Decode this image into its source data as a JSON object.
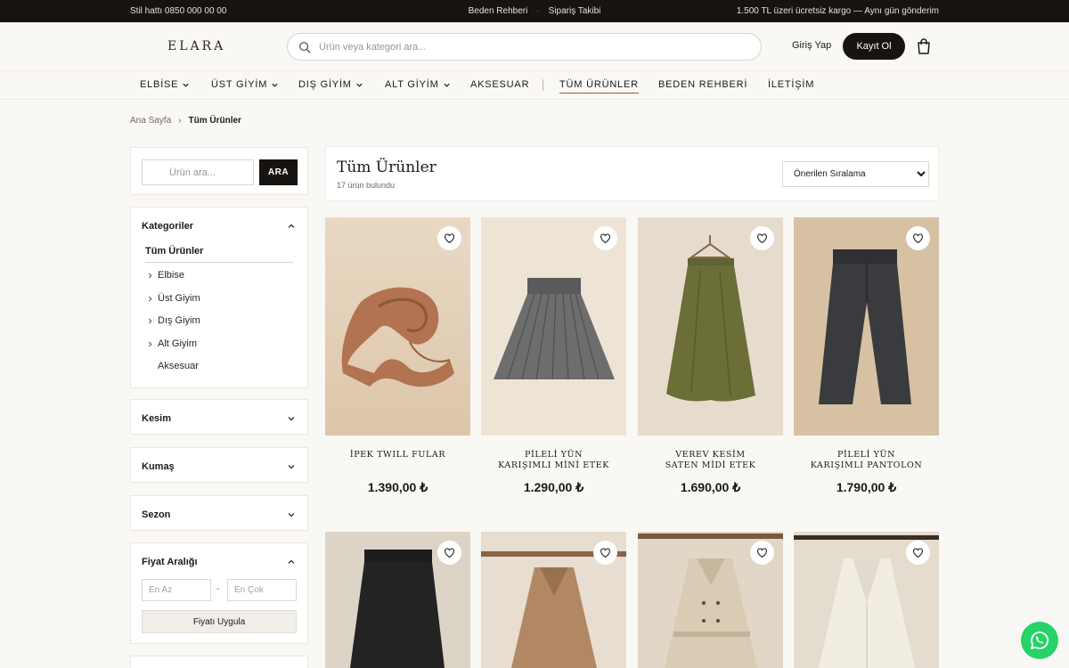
{
  "topbar": {
    "hotline": "Stil hattı 0850 000 00 00",
    "links": [
      "Beden Rehberi",
      "Sipariş Takibi"
    ],
    "promo": "1.500 TL üzeri ücretsiz kargo — Aynı gün gönderim"
  },
  "header": {
    "logo": "ELARA",
    "search_placeholder": "Ürün veya kategori ara...",
    "login": "Giriş Yap",
    "signup": "Kayıt Ol"
  },
  "nav": {
    "items": [
      "ELBİSE",
      "ÜST GİYİM",
      "DIŞ GİYİM",
      "ALT GİYİM",
      "AKSESUAR",
      "TÜM ÜRÜNLER",
      "BEDEN REHBERİ",
      "İLETİŞİM"
    ]
  },
  "breadcrumb": {
    "home": "Ana Sayfa",
    "current": "Tüm Ürünler"
  },
  "sidebar": {
    "search_placeholder": "Ürün ara...",
    "search_button": "ARA",
    "categories_title": "Kategoriler",
    "all": "Tüm Ürünler",
    "subs": [
      "Elbise",
      "Üst Giyim",
      "Dış Giyim",
      "Alt Giyim",
      "Aksesuar"
    ],
    "filters": [
      "Kesim",
      "Kumaş",
      "Sezon"
    ],
    "price_title": "Fiyat Aralığı",
    "price_min_placeholder": "En Az",
    "price_max_placeholder": "En Çok",
    "price_apply": "Fiyatı Uygula"
  },
  "listing": {
    "title": "Tüm Ürünler",
    "count": "17 ürün bulundu",
    "sort": "Önerilen Sıralama"
  },
  "products": [
    {
      "name": "İPEK TWILL FULAR",
      "price": "1.390,00 ₺"
    },
    {
      "name": "PİLELİ YÜN\nKARIŞIMLI MİNİ ETEK",
      "price": "1.290,00 ₺"
    },
    {
      "name": "VEREV KESİM\nSATEN MİDİ ETEK",
      "price": "1.690,00 ₺"
    },
    {
      "name": "PİLELİ YÜN\nKARIŞIMLI PANTOLON",
      "price": "1.790,00 ₺"
    }
  ],
  "colors": {
    "dark": "#161311",
    "accent": "#8b5e3c",
    "whatsapp": "#25d366"
  }
}
